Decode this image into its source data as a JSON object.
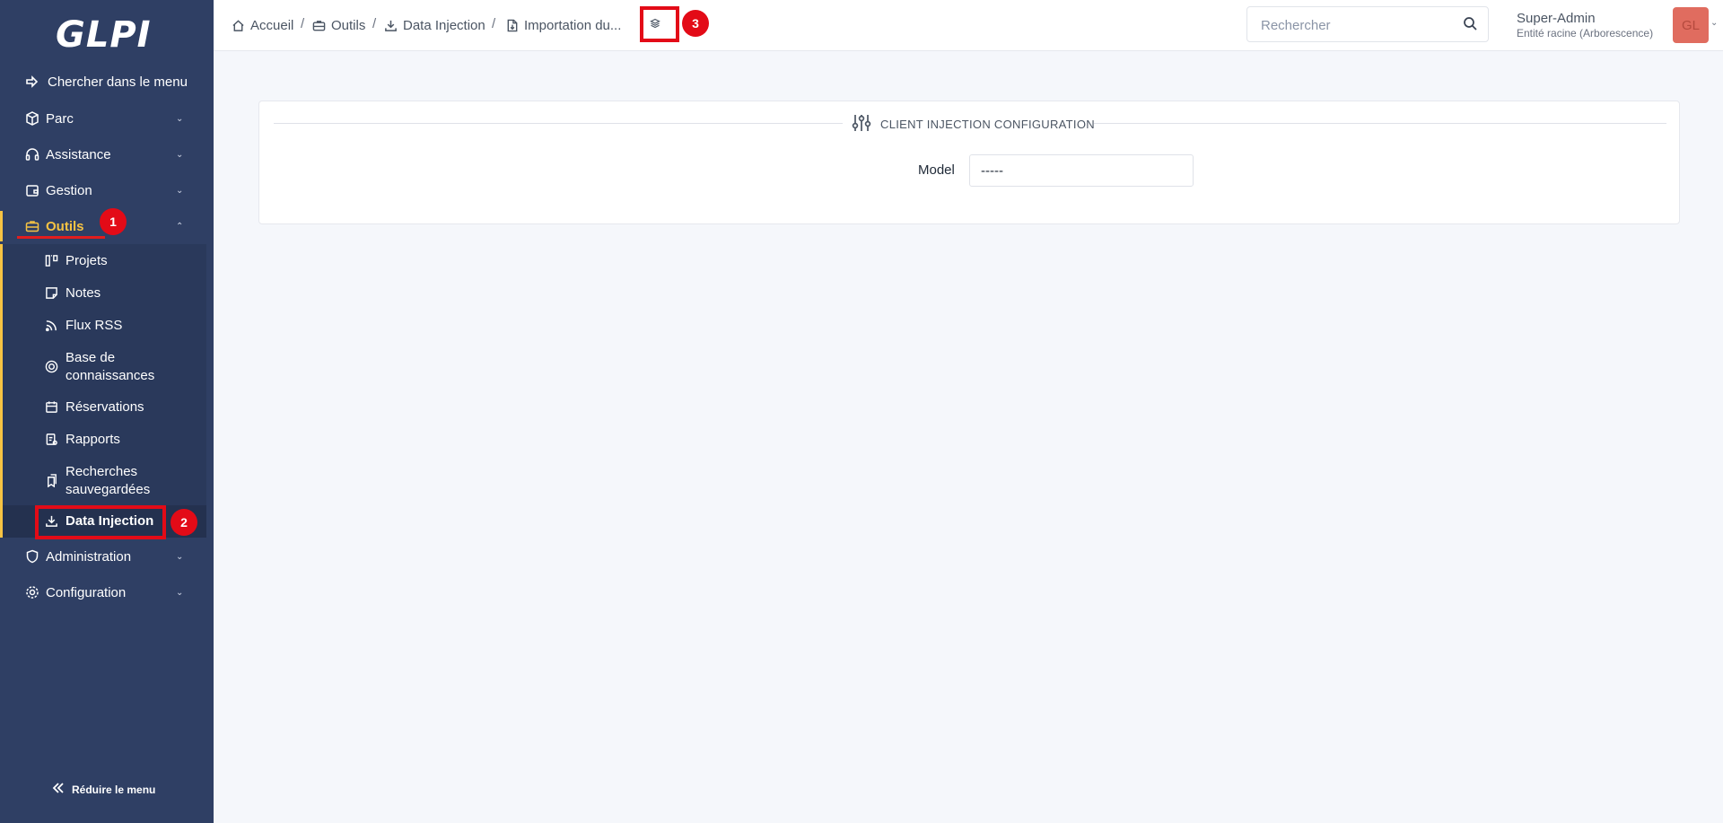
{
  "app": {
    "logo_text": "GLPI"
  },
  "sidebar": {
    "search_menu_label": "Chercher dans le menu",
    "items": [
      {
        "label": "Parc"
      },
      {
        "label": "Assistance"
      },
      {
        "label": "Gestion"
      },
      {
        "label": "Outils"
      },
      {
        "label": "Administration"
      },
      {
        "label": "Configuration"
      }
    ],
    "outils_submenu": [
      {
        "label": "Projets"
      },
      {
        "label": "Notes"
      },
      {
        "label": "Flux RSS"
      },
      {
        "label": "Base de connaissances"
      },
      {
        "label": "Réservations"
      },
      {
        "label": "Rapports"
      },
      {
        "label": "Recherches sauvegardées"
      },
      {
        "label": "Data Injection"
      }
    ],
    "collapse_label": "Réduire le menu"
  },
  "breadcrumb": [
    {
      "label": "Accueil"
    },
    {
      "label": "Outils"
    },
    {
      "label": "Data Injection"
    },
    {
      "label": "Importation du..."
    }
  ],
  "search": {
    "placeholder": "Rechercher"
  },
  "user": {
    "name": "Super-Admin",
    "entity": "Entité racine (Arborescence)",
    "initials": "GL"
  },
  "card": {
    "title": "CLIENT INJECTION CONFIGURATION",
    "model_label": "Model",
    "model_value": "-----"
  },
  "annotations": [
    "1",
    "2",
    "3"
  ],
  "colors": {
    "sidebar_bg": "#2f3f64",
    "accent": "#f6c343",
    "annotation_red": "#e30b17"
  }
}
